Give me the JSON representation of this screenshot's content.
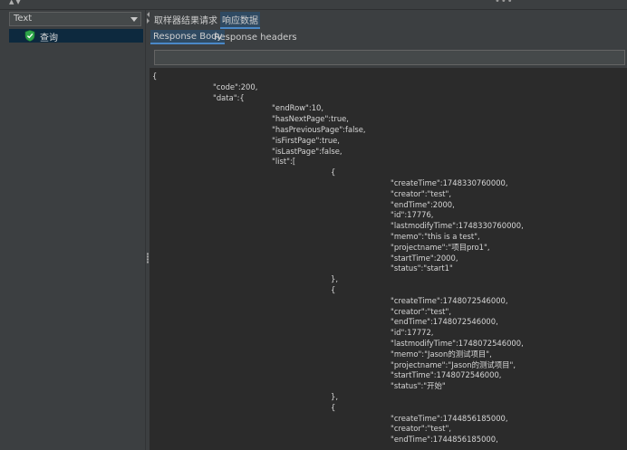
{
  "left": {
    "combo_value": "Text",
    "tree": [
      {
        "label": "查询",
        "status": "success"
      }
    ]
  },
  "tabs": [
    "取样器结果",
    "请求",
    "响应数据"
  ],
  "selected_tab": "响应数据",
  "subtabs": [
    "Response Body",
    "Response headers"
  ],
  "selected_subtab": "Response Body",
  "response_lines": [
    {
      "indent": 0,
      "text": "{"
    },
    {
      "indent": 1,
      "text": "\"code\":200,"
    },
    {
      "indent": 1,
      "text": "\"data\":{"
    },
    {
      "indent": 2,
      "text": "\"endRow\":10,"
    },
    {
      "indent": 2,
      "text": "\"hasNextPage\":true,"
    },
    {
      "indent": 2,
      "text": "\"hasPreviousPage\":false,"
    },
    {
      "indent": 2,
      "text": "\"isFirstPage\":true,"
    },
    {
      "indent": 2,
      "text": "\"isLastPage\":false,"
    },
    {
      "indent": 2,
      "text": "\"list\":["
    },
    {
      "indent": 3,
      "text": "{"
    },
    {
      "indent": 4,
      "text": "\"createTime\":1748330760000,"
    },
    {
      "indent": 4,
      "text": "\"creator\":\"test\","
    },
    {
      "indent": 4,
      "text": "\"endTime\":2000,"
    },
    {
      "indent": 4,
      "text": "\"id\":17776,"
    },
    {
      "indent": 4,
      "text": "\"lastmodifyTime\":1748330760000,"
    },
    {
      "indent": 4,
      "text": "\"memo\":\"this is a test\","
    },
    {
      "indent": 4,
      "text": "\"projectname\":\"项目pro1\","
    },
    {
      "indent": 4,
      "text": "\"startTime\":2000,"
    },
    {
      "indent": 4,
      "text": "\"status\":\"start1\""
    },
    {
      "indent": 3,
      "text": "},"
    },
    {
      "indent": 3,
      "text": "{"
    },
    {
      "indent": 4,
      "text": "\"createTime\":1748072546000,"
    },
    {
      "indent": 4,
      "text": "\"creator\":\"test\","
    },
    {
      "indent": 4,
      "text": "\"endTime\":1748072546000,"
    },
    {
      "indent": 4,
      "text": "\"id\":17772,"
    },
    {
      "indent": 4,
      "text": "\"lastmodifyTime\":1748072546000,"
    },
    {
      "indent": 4,
      "text": "\"memo\":\"Jason的测试项目\","
    },
    {
      "indent": 4,
      "text": "\"projectname\":\"Jason的测试项目\","
    },
    {
      "indent": 4,
      "text": "\"startTime\":1748072546000,"
    },
    {
      "indent": 4,
      "text": "\"status\":\"开始\""
    },
    {
      "indent": 3,
      "text": "},"
    },
    {
      "indent": 3,
      "text": "{"
    },
    {
      "indent": 4,
      "text": "\"createTime\":1744856185000,"
    },
    {
      "indent": 4,
      "text": "\"creator\":\"test\","
    },
    {
      "indent": 4,
      "text": "\"endTime\":1744856185000,"
    }
  ]
}
